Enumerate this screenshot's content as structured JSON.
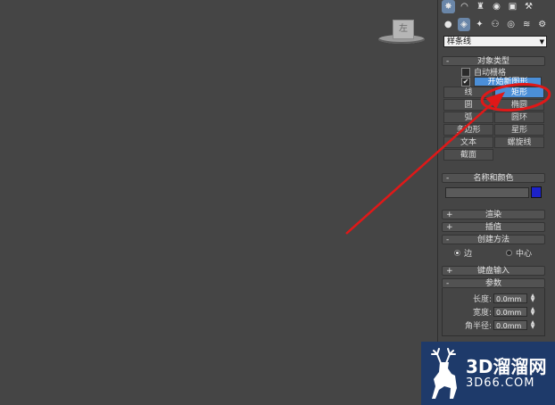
{
  "viewport": {
    "viewcube_label": "左"
  },
  "panel": {
    "dropdown": {
      "selected": "样条线"
    },
    "object_type": {
      "header": "对象类型",
      "auto_grid": "自动栅格",
      "start_new_shape": "开始新图形",
      "buttons": [
        {
          "label": "线",
          "active": false
        },
        {
          "label": "矩形",
          "active": true
        },
        {
          "label": "圆",
          "active": false
        },
        {
          "label": "椭圆",
          "active": false
        },
        {
          "label": "弧",
          "active": false
        },
        {
          "label": "圆环",
          "active": false
        },
        {
          "label": "多边形",
          "active": false
        },
        {
          "label": "星形",
          "active": false
        },
        {
          "label": "文本",
          "active": false
        },
        {
          "label": "螺旋线",
          "active": false
        },
        {
          "label": "截面",
          "active": false
        }
      ]
    },
    "name_color": {
      "header": "名称和颜色",
      "name_value": "",
      "color": "#1c22c9"
    },
    "rollouts": {
      "render": "渲染",
      "interpolation": "插值"
    },
    "creation_method": {
      "header": "创建方法",
      "option_edge": "边",
      "option_center": "中心",
      "selected": "边"
    },
    "keyboard_entry": {
      "header": "键盘输入"
    },
    "parameters": {
      "header": "参数",
      "length_label": "长度:",
      "length_value": "0.0mm",
      "width_label": "宽度:",
      "width_value": "0.0mm",
      "corner_label": "角半径:",
      "corner_value": "0.0mm"
    }
  },
  "watermark": {
    "main": "3D溜溜网",
    "sub": "3D66.COM"
  },
  "colors": {
    "annotation": "#e01818",
    "accent": "#4b8fd8",
    "watermark_bg": "#1e3a6a"
  }
}
